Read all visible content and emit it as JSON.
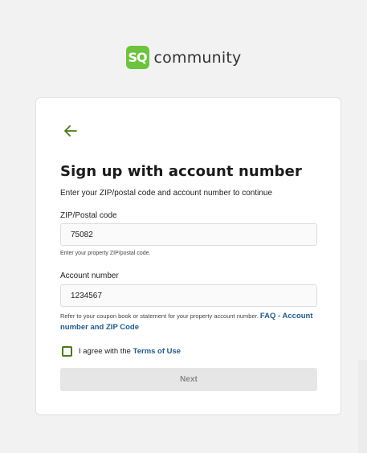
{
  "brand": {
    "mark": "SQ",
    "name": "community",
    "mark_color": "#6cc43c"
  },
  "form": {
    "title": "Sign up with account number",
    "subtitle": "Enter your ZIP/postal code and account number to continue",
    "zip": {
      "label": "ZIP/Postal code",
      "value": "75082",
      "hint": "Enter your property ZIP/postal code."
    },
    "account": {
      "label": "Account number",
      "value": "1234567",
      "hint": "Refer to your coupon book or statement for your property account number.",
      "link": "FAQ - Account number and ZIP Code"
    },
    "agree": {
      "prefix": "I agree with the",
      "link": "Terms of Use",
      "checked": false
    },
    "next_label": "Next"
  },
  "icons": {
    "back": "arrow-left-icon",
    "back_color": "#4a7a14",
    "link_color": "#1f5b8f"
  }
}
